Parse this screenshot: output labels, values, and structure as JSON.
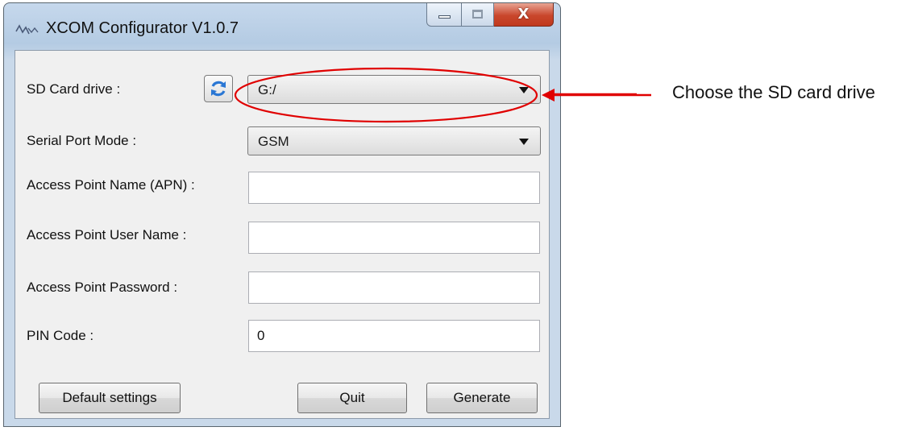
{
  "window": {
    "title": "XCOM Configurator V1.0.7",
    "app_icon": "waveform-icon",
    "controls": {
      "minimize": "minimize-icon",
      "maximize": "maximize-icon",
      "close_glyph": "X"
    }
  },
  "form": {
    "sd_card": {
      "label": "SD Card drive :",
      "value": "G:/",
      "refresh_icon": "refresh-icon"
    },
    "serial_port_mode": {
      "label": "Serial Port Mode :",
      "value": "GSM"
    },
    "apn": {
      "label": "Access Point Name (APN) :",
      "value": ""
    },
    "ap_user": {
      "label": "Access Point User Name :",
      "value": ""
    },
    "ap_password": {
      "label": "Access Point Password :",
      "value": ""
    },
    "pin_code": {
      "label": "PIN Code :",
      "value": "0"
    }
  },
  "buttons": {
    "default_settings": "Default settings",
    "quit": "Quit",
    "generate": "Generate"
  },
  "annotation": {
    "text": "Choose the SD card drive",
    "color": "#e00000"
  },
  "colors": {
    "close_button": "#c9462c",
    "title_bar": "#b4cbe3",
    "refresh_icon": "#2a77d4"
  }
}
